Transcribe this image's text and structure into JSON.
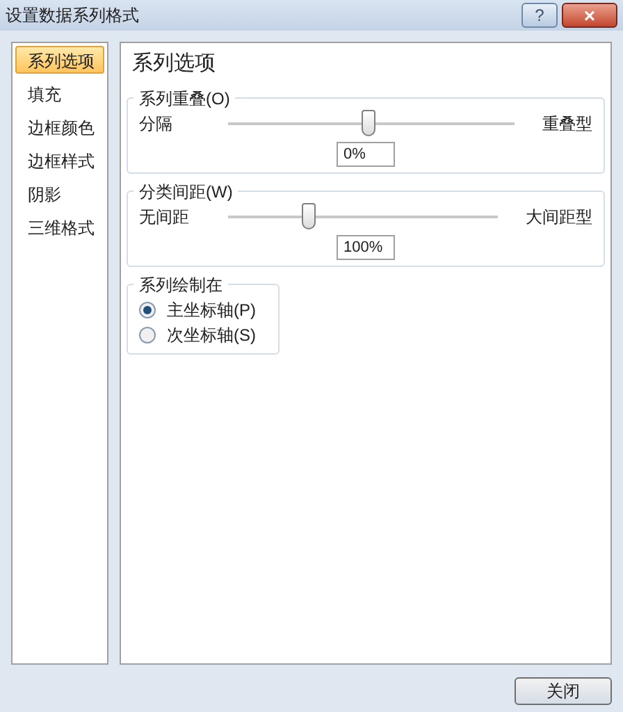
{
  "window": {
    "title": "设置数据系列格式",
    "help": "?",
    "close": "×"
  },
  "sidebar": {
    "items": [
      {
        "label": "系列选项",
        "selected": true
      },
      {
        "label": "填充",
        "selected": false
      },
      {
        "label": "边框颜色",
        "selected": false
      },
      {
        "label": "边框样式",
        "selected": false
      },
      {
        "label": "阴影",
        "selected": false
      },
      {
        "label": "三维格式",
        "selected": false
      }
    ]
  },
  "panel": {
    "title": "系列选项",
    "sliders": [
      {
        "group": "系列重叠(O)",
        "left": "分隔",
        "right": "重叠型",
        "level": 0.49,
        "value": "0%"
      },
      {
        "group": "分类间距(W)",
        "left": "无间距",
        "right": "大间距型",
        "level": 0.3,
        "value": "100%"
      }
    ],
    "plot_on": {
      "group": "系列绘制在",
      "options": [
        {
          "label": "主坐标轴(P)",
          "selected": true
        },
        {
          "label": "次坐标轴(S)",
          "selected": false
        }
      ]
    }
  },
  "buttons": [
    "关闭"
  ]
}
